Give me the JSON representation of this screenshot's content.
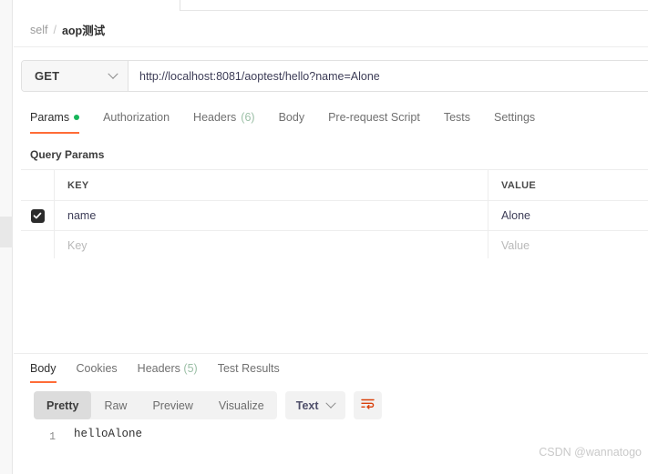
{
  "breadcrumb": {
    "root": "self",
    "separator": "/",
    "current": "aop测试"
  },
  "request": {
    "method": "GET",
    "method_caret_icon": "chevron-down-icon",
    "url": "http://localhost:8081/aoptest/hello?name=Alone",
    "tabs": [
      {
        "label": "Params",
        "indicator": "green-dot",
        "active": true
      },
      {
        "label": "Authorization",
        "active": false
      },
      {
        "label": "Headers",
        "count": "(6)",
        "active": false
      },
      {
        "label": "Body",
        "active": false
      },
      {
        "label": "Pre-request Script",
        "active": false
      },
      {
        "label": "Tests",
        "active": false
      },
      {
        "label": "Settings",
        "active": false
      }
    ]
  },
  "query_params": {
    "section_title": "Query Params",
    "columns": {
      "key": "KEY",
      "value": "VALUE"
    },
    "rows": [
      {
        "checked": true,
        "key": "name",
        "value": "Alone"
      }
    ],
    "new_row": {
      "key_placeholder": "Key",
      "value_placeholder": "Value"
    }
  },
  "response": {
    "tabs": [
      {
        "label": "Body",
        "active": true
      },
      {
        "label": "Cookies",
        "active": false
      },
      {
        "label": "Headers",
        "count": "(5)",
        "active": false
      },
      {
        "label": "Test Results",
        "active": false
      }
    ],
    "format_modes": [
      {
        "label": "Pretty",
        "active": true
      },
      {
        "label": "Raw",
        "active": false
      },
      {
        "label": "Preview",
        "active": false
      },
      {
        "label": "Visualize",
        "active": false
      }
    ],
    "content_type": "Text",
    "content_type_caret_icon": "chevron-down-icon",
    "wrap_button_icon": "word-wrap-icon",
    "body_lines": [
      {
        "number": "1",
        "text": "helloAlone"
      }
    ]
  },
  "watermark": "CSDN @wannatogo",
  "colors": {
    "accent": "#ff6c37",
    "success": "#17b55a",
    "count": "#9bbfa6",
    "text": "#2f2f2f",
    "muted": "#707070",
    "border": "#ededed",
    "checkbox": "#2b2b2b"
  }
}
